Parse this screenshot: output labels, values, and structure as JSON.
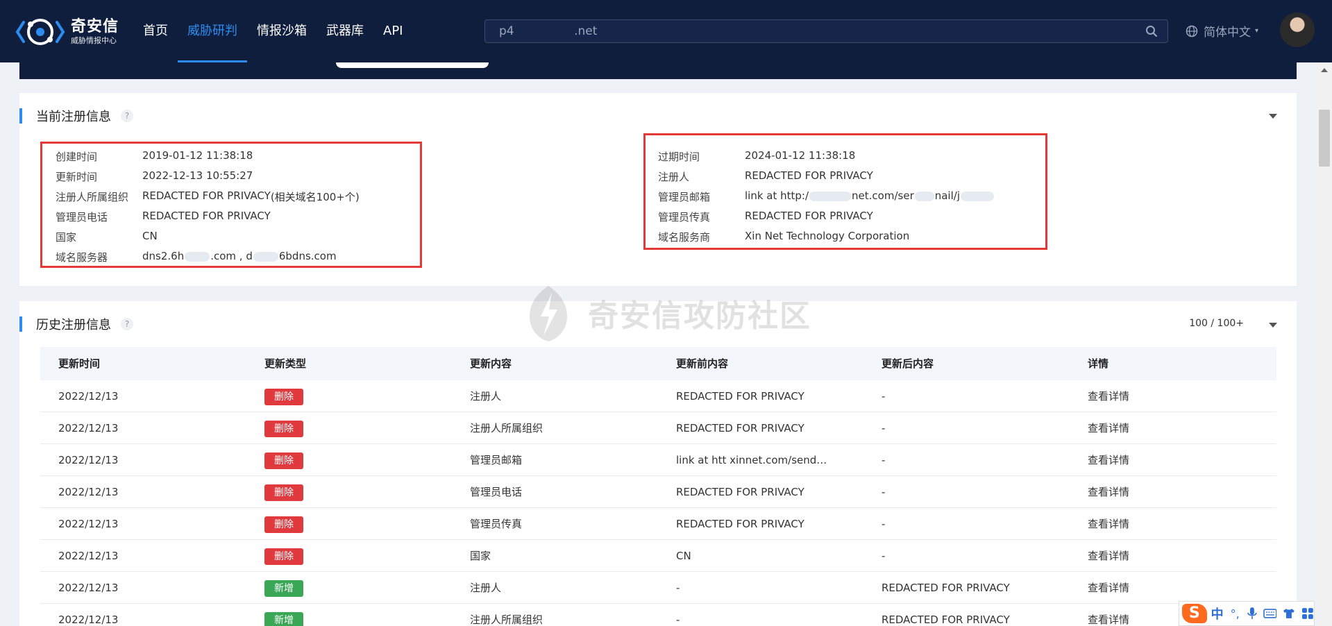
{
  "header": {
    "logo_name": "奇安信",
    "logo_sub": "威胁情报中心",
    "nav": [
      {
        "label": "首页",
        "active": false
      },
      {
        "label": "威胁研判",
        "active": true
      },
      {
        "label": "情报沙箱",
        "active": false
      },
      {
        "label": "武器库",
        "active": false
      },
      {
        "label": "API",
        "active": false
      }
    ],
    "search_value": "p4                .net",
    "language": "简体中文"
  },
  "current": {
    "title": "当前注册信息",
    "help": "?",
    "left": [
      {
        "k": "创建时间",
        "v": "2019-01-12 11:38:18"
      },
      {
        "k": "更新时间",
        "v": "2022-12-13 10:55:27"
      },
      {
        "k": "注册人所属组织",
        "v": "REDACTED FOR PRIVACY",
        "extra": "(相关域名100+个)"
      },
      {
        "k": "管理员电话",
        "v": "REDACTED FOR PRIVACY"
      },
      {
        "k": "国家",
        "v": "CN"
      },
      {
        "k": "域名服务器",
        "v1": "dns2.6h",
        "v2": ".com , d",
        "v3": "6bdns.com"
      }
    ],
    "right": [
      {
        "k": "过期时间",
        "v": "2024-01-12 11:38:18"
      },
      {
        "k": "注册人",
        "v": "REDACTED FOR PRIVACY"
      },
      {
        "k": "管理员邮箱",
        "v1": "link at http:/",
        "v2": "net.com/ser",
        "v3": "nail/j"
      },
      {
        "k": "管理员传真",
        "v": "REDACTED FOR PRIVACY"
      },
      {
        "k": "域名服务商",
        "v": "Xin Net Technology Corporation"
      }
    ]
  },
  "history": {
    "title": "历史注册信息",
    "help": "?",
    "count": "100 / 100+",
    "columns": [
      "更新时间",
      "更新类型",
      "更新内容",
      "更新前内容",
      "更新后内容",
      "详情"
    ],
    "rows": [
      {
        "time": "2022/12/13",
        "type": "删除",
        "type_color": "red",
        "field": "注册人",
        "before": "REDACTED FOR PRIVACY",
        "before_link": true,
        "after": "-",
        "after_link": false,
        "detail": "查看详情"
      },
      {
        "time": "2022/12/13",
        "type": "删除",
        "type_color": "red",
        "field": "注册人所属组织",
        "before": "REDACTED FOR PRIVACY",
        "before_link": true,
        "after": "-",
        "after_link": false,
        "detail": "查看详情"
      },
      {
        "time": "2022/12/13",
        "type": "删除",
        "type_color": "red",
        "field": "管理员邮箱",
        "before": "link at htt        xinnet.com/send…",
        "before_link": false,
        "after": "-",
        "after_link": false,
        "detail": "查看详情"
      },
      {
        "time": "2022/12/13",
        "type": "删除",
        "type_color": "red",
        "field": "管理员电话",
        "before": "REDACTED FOR PRIVACY",
        "before_link": false,
        "after": "-",
        "after_link": false,
        "detail": "查看详情"
      },
      {
        "time": "2022/12/13",
        "type": "删除",
        "type_color": "red",
        "field": "管理员传真",
        "before": "REDACTED FOR PRIVACY",
        "before_link": false,
        "after": "-",
        "after_link": false,
        "detail": "查看详情"
      },
      {
        "time": "2022/12/13",
        "type": "删除",
        "type_color": "red",
        "field": "国家",
        "before": "CN",
        "before_link": false,
        "after": "-",
        "after_link": false,
        "detail": "查看详情"
      },
      {
        "time": "2022/12/13",
        "type": "新增",
        "type_color": "green",
        "field": "注册人",
        "before": "-",
        "before_link": false,
        "after": "REDACTED FOR PRIVACY",
        "after_link": true,
        "detail": "查看详情"
      },
      {
        "time": "2022/12/13",
        "type": "新增",
        "type_color": "green",
        "field": "注册人所属组织",
        "before": "-",
        "before_link": false,
        "after": "REDACTED FOR PRIVACY",
        "after_link": true,
        "detail": "查看详情"
      }
    ]
  },
  "watermark": "奇安信攻防社区",
  "ime": {
    "logo": "S",
    "mode": "中",
    "punct": "°,"
  },
  "colors": {
    "header_bg": "#0f1e3d",
    "accent": "#2d8cf0",
    "highlight_box": "#e53935",
    "delete_tag": "#e0393e",
    "add_tag": "#3aa757"
  }
}
